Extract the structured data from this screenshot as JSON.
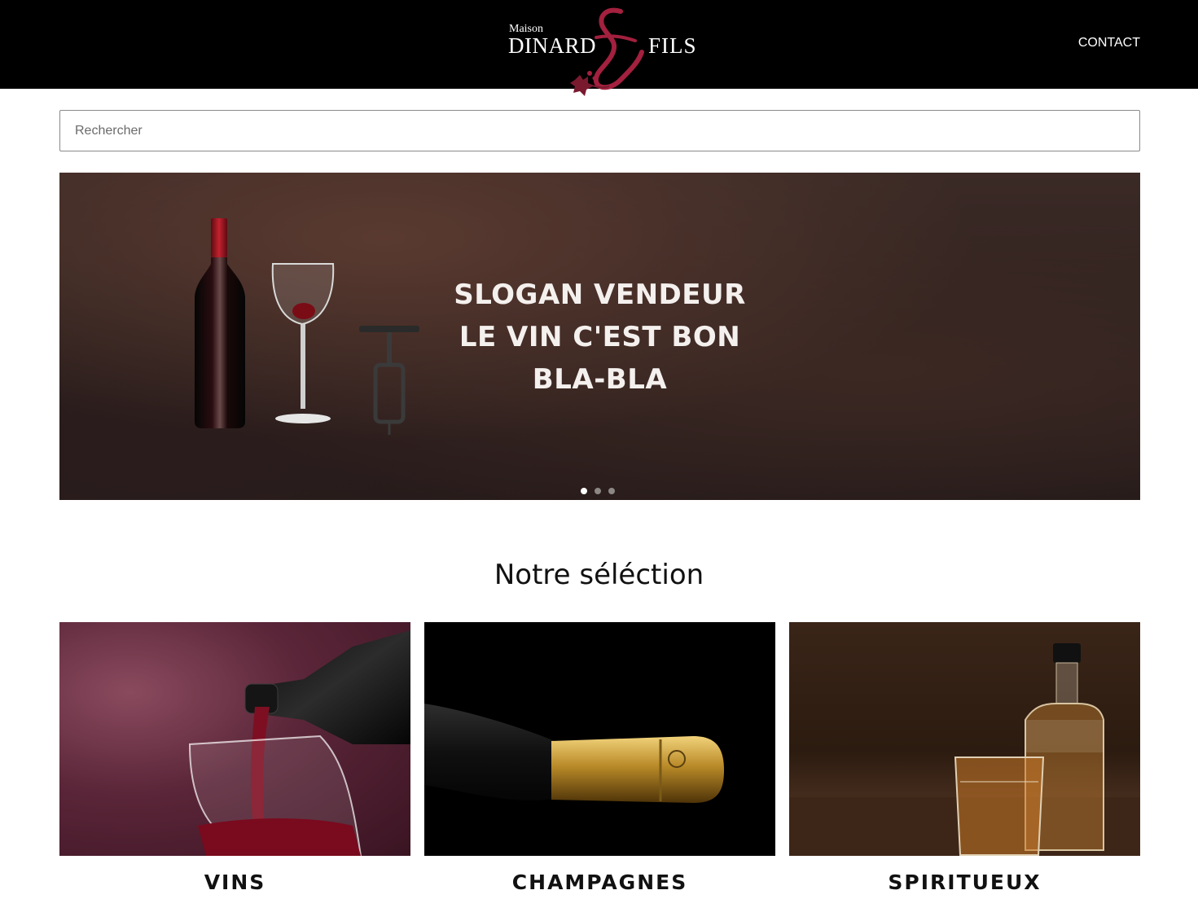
{
  "header": {
    "logo": {
      "line1": "Maison",
      "line2": "DINARD",
      "line3": "FILS"
    },
    "nav": {
      "contact": "CONTACT"
    }
  },
  "search": {
    "placeholder": "Rechercher",
    "value": ""
  },
  "hero": {
    "slogan": [
      "SLOGAN VENDEUR",
      "LE VIN C'EST BON",
      "BLA-BLA"
    ],
    "slides_total": 3,
    "active_slide": 1
  },
  "selection": {
    "title": "Notre séléction",
    "items": [
      {
        "label": "VINS",
        "image": "wine-pouring-into-glass"
      },
      {
        "label": "CHAMPAGNES",
        "image": "champagne-bottle-neck"
      },
      {
        "label": "SPIRITUEUX",
        "image": "whiskey-bottle-and-glass"
      }
    ]
  },
  "colors": {
    "header_bg": "#000000",
    "logo_accent": "#a3203e",
    "hero_bg": "#2f221f",
    "text_dark": "#111111"
  }
}
